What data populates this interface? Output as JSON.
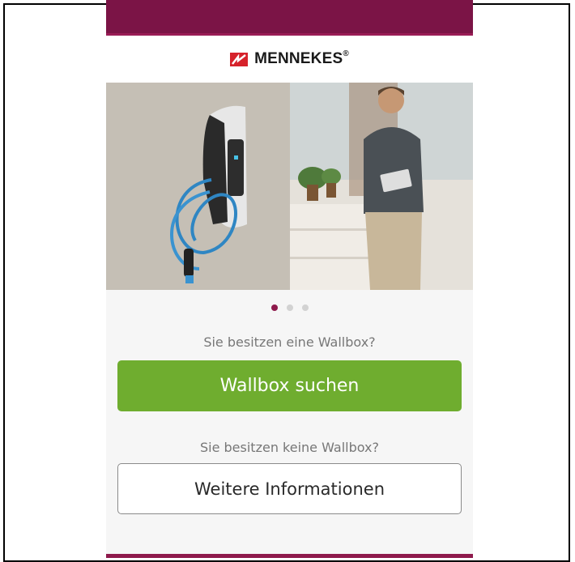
{
  "brand": {
    "name": "MENNEKES",
    "mark": "®",
    "primary_color": "#7b1446",
    "logo_color": "#d6222b"
  },
  "hero": {
    "slides": 3,
    "active_slide": 1
  },
  "section_owner": {
    "question": "Sie besitzen eine Wallbox?",
    "button_label": "Wallbox suchen",
    "button_color": "#6fad2f"
  },
  "section_no_owner": {
    "question": "Sie besitzen keine Wallbox?",
    "button_label": "Weitere Informationen"
  }
}
